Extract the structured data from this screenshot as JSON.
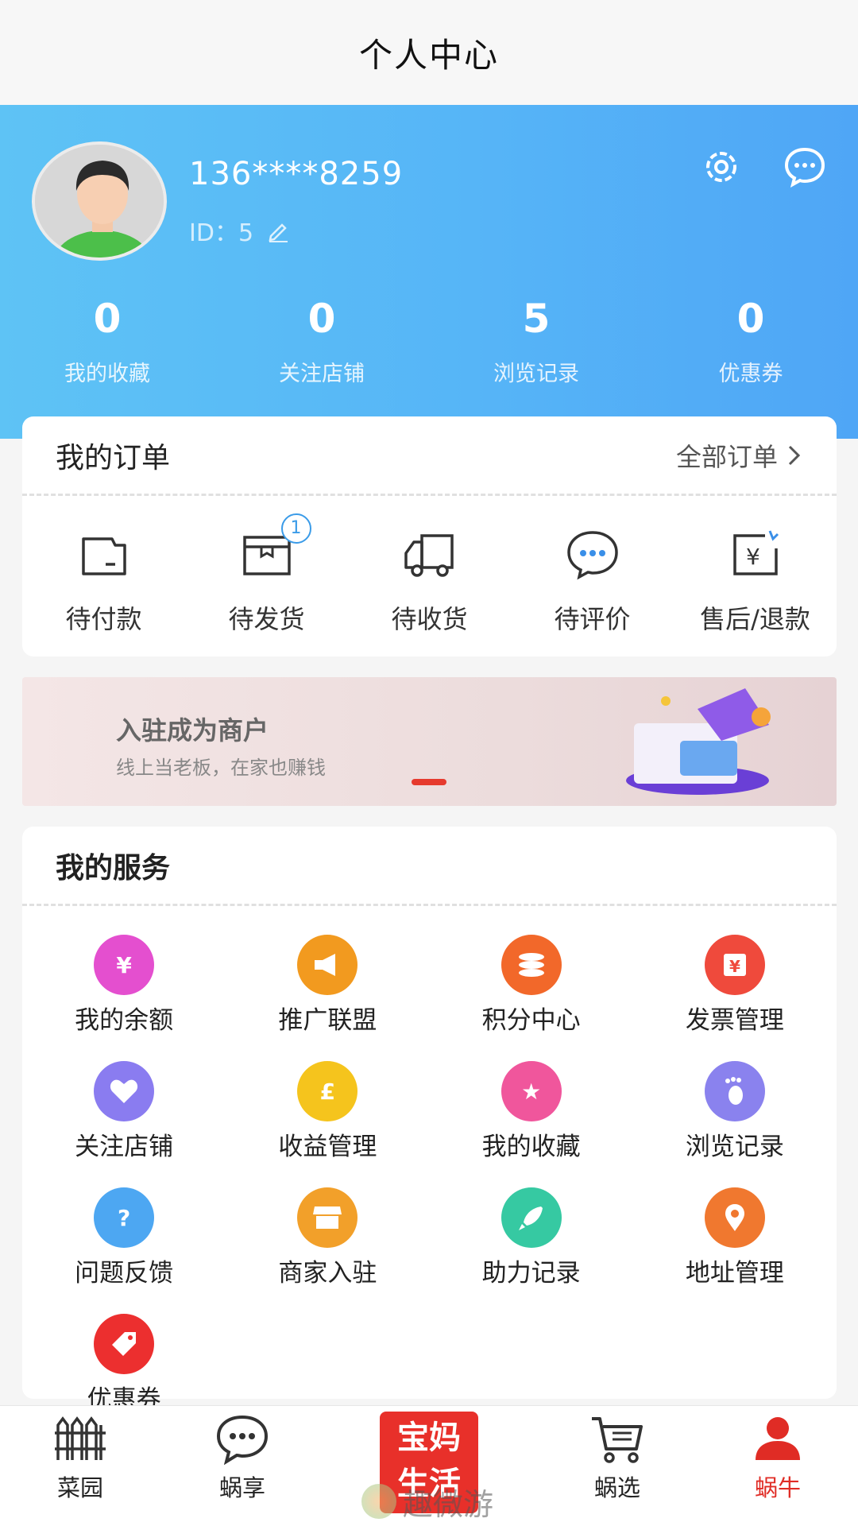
{
  "header": {
    "title": "个人中心"
  },
  "profile": {
    "phone": "136****8259",
    "id_label": "ID：5"
  },
  "stats": [
    {
      "value": "0",
      "label": "我的收藏"
    },
    {
      "value": "0",
      "label": "关注店铺"
    },
    {
      "value": "5",
      "label": "浏览记录"
    },
    {
      "value": "0",
      "label": "优惠券"
    }
  ],
  "orders": {
    "title": "我的订单",
    "all_label": "全部订单",
    "items": [
      {
        "label": "待付款",
        "icon": "wallet-icon"
      },
      {
        "label": "待发货",
        "icon": "box-icon",
        "badge": "1"
      },
      {
        "label": "待收货",
        "icon": "truck-icon"
      },
      {
        "label": "待评价",
        "icon": "chat-icon"
      },
      {
        "label": "售后/退款",
        "icon": "refund-icon"
      }
    ]
  },
  "banner": {
    "title": "入驻成为商户",
    "subtitle": "线上当老板，在家也赚钱"
  },
  "services": {
    "title": "我的服务",
    "items": [
      {
        "label": "我的余额",
        "icon": "money-bag-icon",
        "color": "#e44fcf"
      },
      {
        "label": "推广联盟",
        "icon": "megaphone-icon",
        "color": "#f29a1f"
      },
      {
        "label": "积分中心",
        "icon": "coins-icon",
        "color": "#f2682a"
      },
      {
        "label": "发票管理",
        "icon": "invoice-icon",
        "color": "#ef4a3c"
      },
      {
        "label": "关注店铺",
        "icon": "heart-icon",
        "color": "#8a7cf0"
      },
      {
        "label": "收益管理",
        "icon": "pound-bag-icon",
        "color": "#f5c41d"
      },
      {
        "label": "我的收藏",
        "icon": "star-icon",
        "color": "#f0569c"
      },
      {
        "label": "浏览记录",
        "icon": "footprint-icon",
        "color": "#8a82ee"
      },
      {
        "label": "问题反馈",
        "icon": "question-icon",
        "color": "#4da7f2"
      },
      {
        "label": "商家入驻",
        "icon": "shop-icon",
        "color": "#f2a02a"
      },
      {
        "label": "助力记录",
        "icon": "rocket-icon",
        "color": "#36c9a2"
      },
      {
        "label": "地址管理",
        "icon": "location-icon",
        "color": "#f0782f"
      },
      {
        "label": "优惠券",
        "icon": "coupon-tag-icon",
        "color": "#ec2f2f"
      }
    ]
  },
  "tabbar": {
    "items": [
      {
        "label": "菜园",
        "icon": "fence-icon"
      },
      {
        "label": "蜗享",
        "icon": "chat-bubble-icon"
      },
      {
        "label": "蜗选",
        "icon": "cart-icon"
      },
      {
        "label": "蜗牛",
        "icon": "user-icon",
        "active": true
      }
    ],
    "center_logo_line1": "宝妈",
    "center_logo_line2": "生活"
  },
  "watermark": {
    "text": "趣微游"
  },
  "colors": {
    "accent": "#e02c25",
    "hero_start": "#5ec3f5",
    "hero_end": "#4fa6f6"
  }
}
